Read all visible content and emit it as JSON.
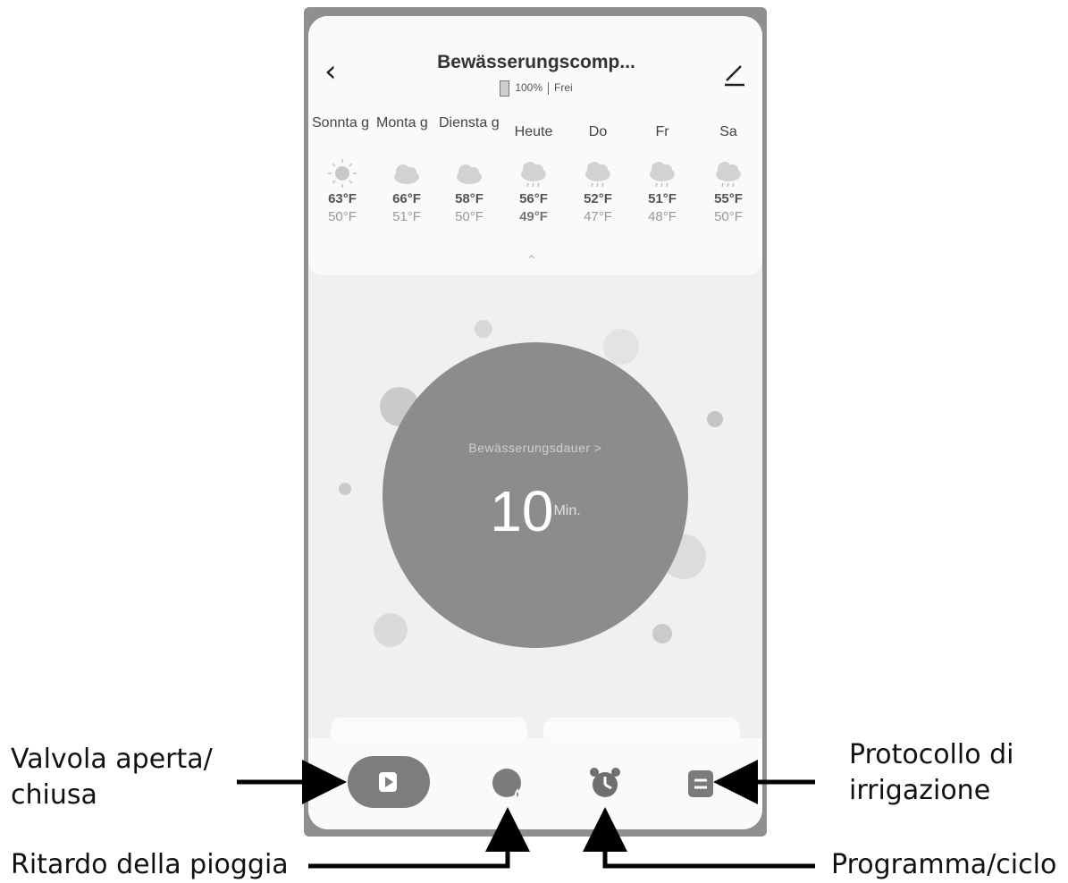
{
  "header": {
    "title": "Bewässerungscomp...",
    "battery": "100%",
    "status": "Frei"
  },
  "forecast": [
    {
      "day": "Sonnta g",
      "icon": "sun-icon",
      "high": "63°F",
      "low": "50°F"
    },
    {
      "day": "Monta g",
      "icon": "cloud-icon",
      "high": "66°F",
      "low": "51°F"
    },
    {
      "day": "Diensta g",
      "icon": "cloud-icon",
      "high": "58°F",
      "low": "50°F"
    },
    {
      "day": "Heute",
      "icon": "rain-cloud-icon",
      "high": "56°F",
      "low": "49°F"
    },
    {
      "day": "Do",
      "icon": "rain-cloud-icon",
      "high": "52°F",
      "low": "47°F"
    },
    {
      "day": "Fr",
      "icon": "rain-cloud-icon",
      "high": "51°F",
      "low": "48°F"
    },
    {
      "day": "Sa",
      "icon": "rain-cloud-icon",
      "high": "55°F",
      "low": "50°F"
    }
  ],
  "duration": {
    "label": "Bewässerungsdauer >",
    "value": "10",
    "unit": "Min."
  },
  "toolbar": {
    "play": "play-icon",
    "rain_delay": "rain-delay-icon",
    "schedule": "alarm-clock-icon",
    "log": "log-icon"
  },
  "annotations": {
    "valve": "Valvola aperta/\nchiusa",
    "rain_delay": "Ritardo della pioggia",
    "protocol": "Protocollo di\nirrigazione",
    "program": "Programma/ciclo"
  },
  "colors": {
    "circle": "#8c8c8c",
    "frame": "#8f8f8f"
  }
}
